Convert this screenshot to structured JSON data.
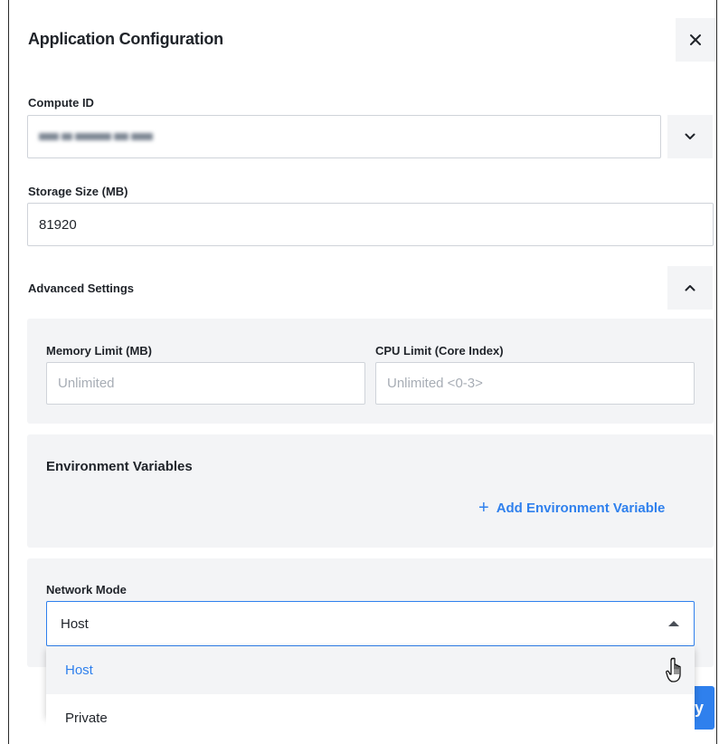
{
  "dialog": {
    "title": "Application Configuration",
    "close_icon": "close-icon"
  },
  "compute": {
    "label": "Compute ID",
    "value": "(redacted)",
    "dropdown_icon": "chevron-down-icon"
  },
  "storage": {
    "label": "Storage Size (MB)",
    "value": "81920"
  },
  "advanced": {
    "label": "Advanced Settings",
    "toggle_icon": "chevron-up-icon",
    "memory": {
      "label": "Memory Limit (MB)",
      "placeholder": "Unlimited"
    },
    "cpu": {
      "label": "CPU Limit (Core Index)",
      "placeholder": "Unlimited <0-3>"
    }
  },
  "env": {
    "title": "Environment Variables",
    "add_label": "Add Environment Variable",
    "add_icon": "plus-icon"
  },
  "network": {
    "label": "Network Mode",
    "value": "Host",
    "caret_icon": "caret-up-icon",
    "options": [
      "Host",
      "Private"
    ],
    "selected_color": "#2f80ed"
  },
  "footer": {
    "primary_partial_label": "y"
  },
  "colors": {
    "accent": "#2f80ed",
    "panel_bg": "#f3f4f6",
    "border": "#cfd3d9",
    "text": "#1f2329",
    "placeholder": "#a7adb5"
  }
}
